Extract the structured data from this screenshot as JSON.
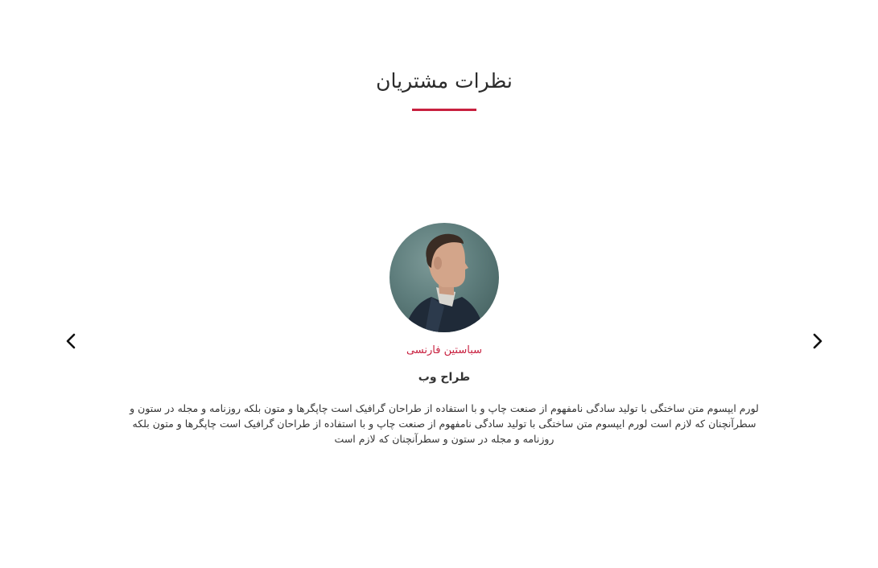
{
  "section": {
    "title": "نظرات مشتریان",
    "accent_color": "#c8203f"
  },
  "testimonial": {
    "name": "سباستین فارنسی",
    "role": "طراح وب",
    "text": "لورم ایپسوم متن ساختگی با تولید سادگی نامفهوم از صنعت چاپ و با استفاده از طراحان گرافیک است چاپگرها و متون بلکه روزنامه و مجله در ستون و سطرآنچنان که لازم است لورم ایپسوم متن ساختگی با تولید سادگی نامفهوم از صنعت چاپ و با استفاده از طراحان گرافیک است چاپگرها و متون بلکه روزنامه و مجله در ستون و سطرآنچنان که لازم است",
    "avatar_icon": "person-portrait"
  },
  "navigation": {
    "prev_icon": "chevron-left-icon",
    "next_icon": "chevron-right-icon"
  }
}
